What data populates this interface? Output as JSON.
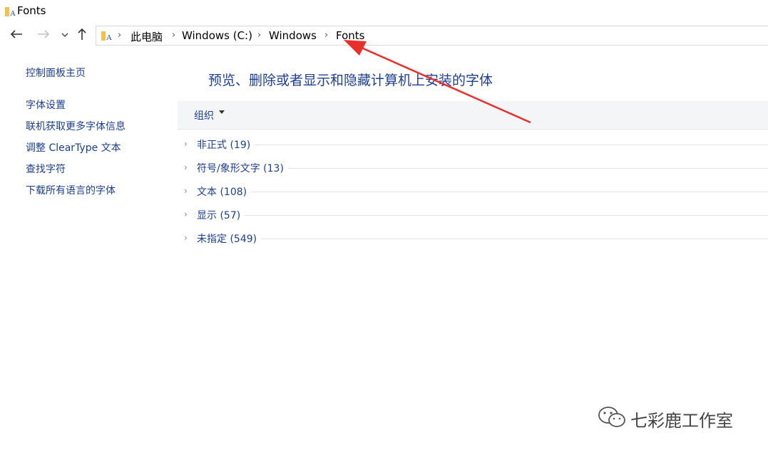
{
  "window": {
    "title": "Fonts"
  },
  "address": {
    "crumbs": [
      "此电脑",
      "Windows (C:)",
      "Windows",
      "Fonts"
    ]
  },
  "nav": {
    "back_icon": "arrow-left-icon",
    "forward_icon": "arrow-right-icon",
    "recent_icon": "chevron-down-icon",
    "up_icon": "arrow-up-icon"
  },
  "sidebar": {
    "home_link": "控制面板主页",
    "links": [
      "字体设置",
      "联机获取更多字体信息",
      "调整 ClearType 文本",
      "查找字符",
      "下载所有语言的字体"
    ]
  },
  "main": {
    "heading": "预览、删除或者显示和隐藏计算机上安装的字体",
    "toolbar": {
      "organize": "组织"
    },
    "groups": [
      {
        "label": "非正式 (19)"
      },
      {
        "label": "符号/象形文字 (13)"
      },
      {
        "label": "文本 (108)"
      },
      {
        "label": "显示 (57)"
      },
      {
        "label": "未指定 (549)"
      }
    ]
  },
  "watermark": {
    "text": "七彩鹿工作室"
  },
  "colors": {
    "link": "#1b3f8f",
    "heading": "#1c3f94",
    "annotation": "#e8302b",
    "folder": "#f2c14e"
  }
}
